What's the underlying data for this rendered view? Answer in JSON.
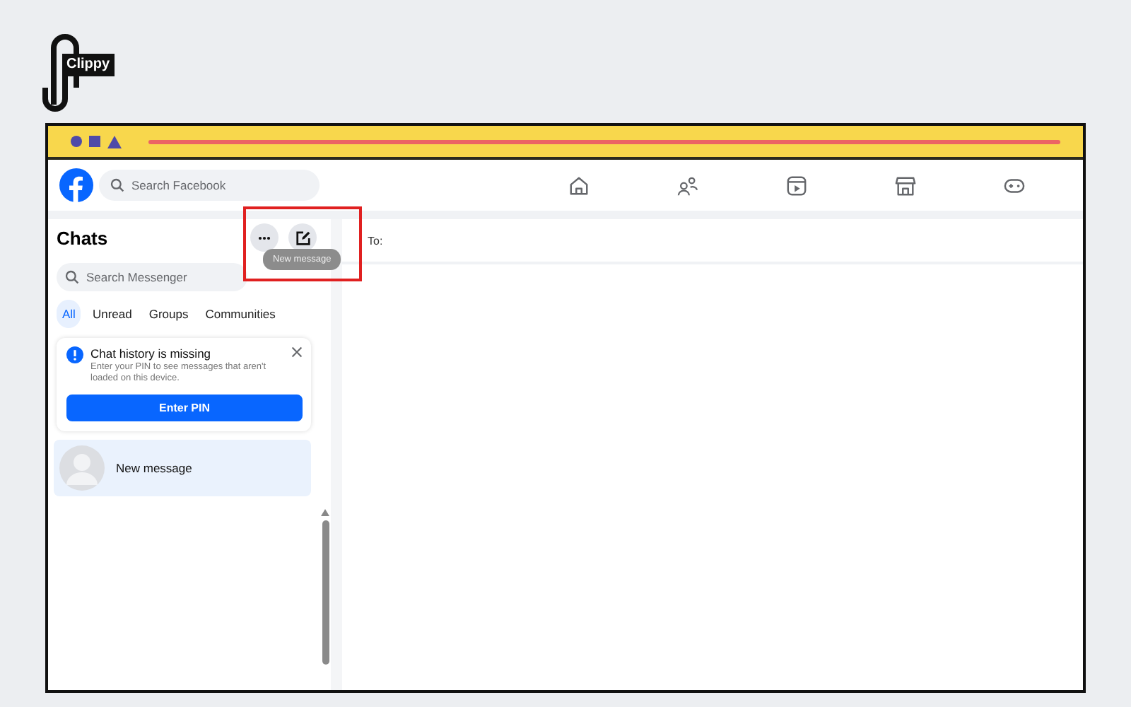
{
  "logo": {
    "text": "Clippy"
  },
  "header": {
    "search": {
      "placeholder": "Search Facebook"
    },
    "nav": [
      {
        "kind": "home"
      },
      {
        "kind": "friends"
      },
      {
        "kind": "video"
      },
      {
        "kind": "marketplace"
      },
      {
        "kind": "gaming"
      }
    ]
  },
  "sidebar": {
    "title": "Chats",
    "tooltip": "New message",
    "search": {
      "placeholder": "Search Messenger"
    },
    "filters": [
      {
        "label": "All",
        "selected": true
      },
      {
        "label": "Unread",
        "selected": false
      },
      {
        "label": "Groups",
        "selected": false
      },
      {
        "label": "Communities",
        "selected": false
      }
    ],
    "notice": {
      "title": "Chat history is missing",
      "body": "Enter your PIN to see messages that aren't loaded on this device.",
      "button": "Enter PIN"
    },
    "chats": [
      {
        "name": "New message",
        "selected": true
      }
    ]
  },
  "compose": {
    "to_label": "To:"
  }
}
